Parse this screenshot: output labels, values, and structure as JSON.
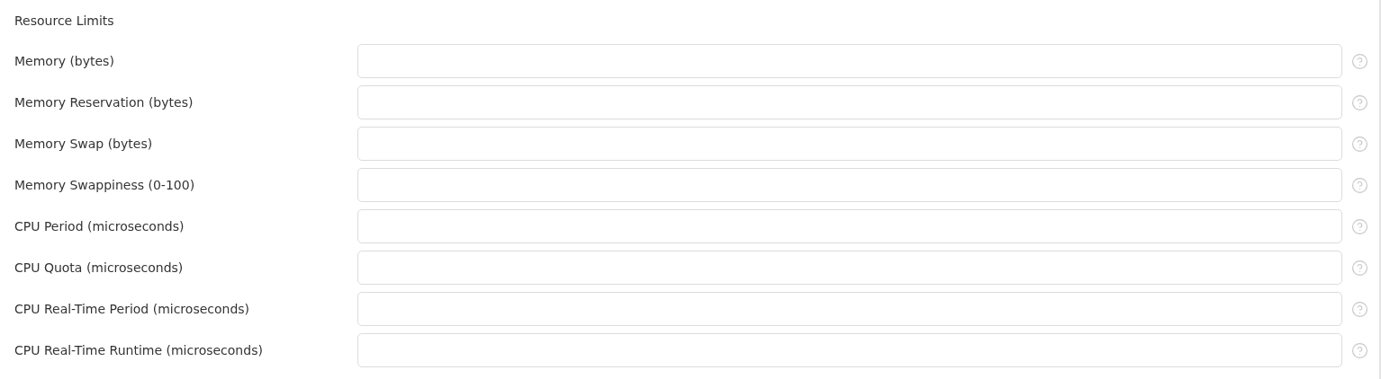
{
  "section": {
    "title": "Resource Limits"
  },
  "fields": [
    {
      "label": "Memory (bytes)"
    },
    {
      "label": "Memory Reservation (bytes)"
    },
    {
      "label": "Memory Swap (bytes)"
    },
    {
      "label": "Memory Swappiness (0-100)"
    },
    {
      "label": "CPU Period (microseconds)"
    },
    {
      "label": "CPU Quota (microseconds)"
    },
    {
      "label": "CPU Real-Time Period (microseconds)"
    },
    {
      "label": "CPU Real-Time Runtime (microseconds)"
    }
  ]
}
